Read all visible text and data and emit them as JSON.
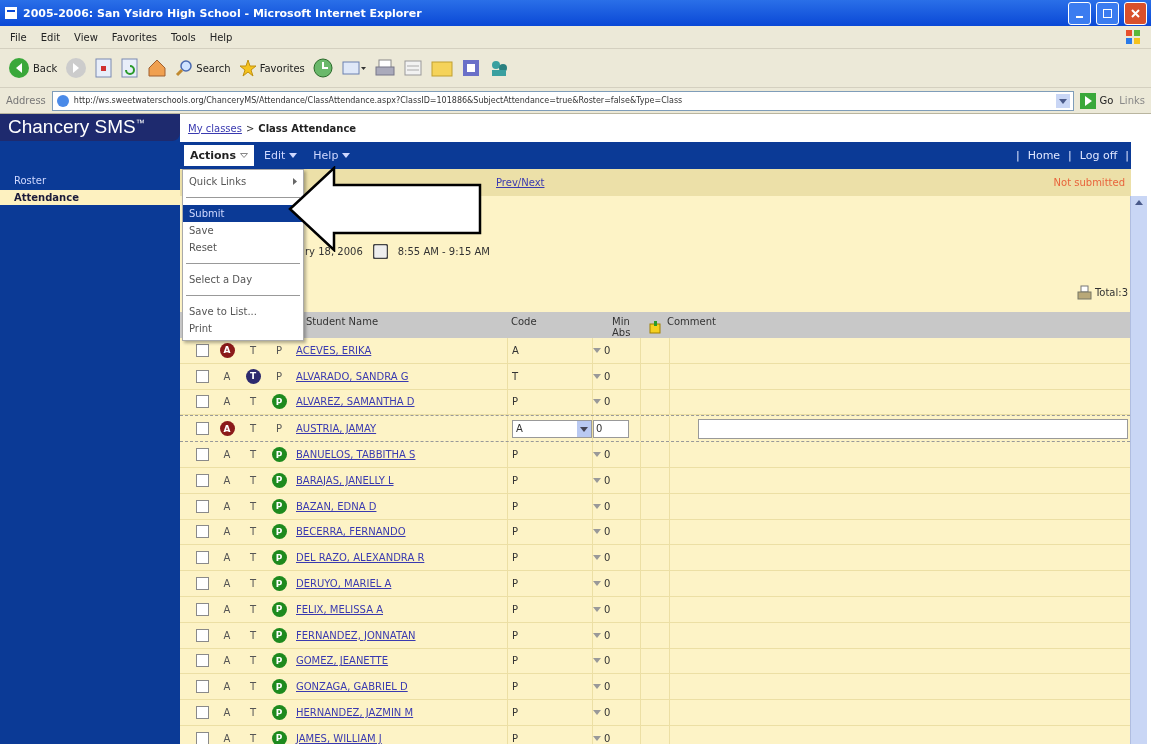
{
  "window": {
    "title": "2005-2006: San Ysidro High School - Microsoft Internet Explorer"
  },
  "menu_bar": [
    "File",
    "Edit",
    "View",
    "Favorites",
    "Tools",
    "Help"
  ],
  "toolbar": {
    "back": "Back",
    "search": "Search",
    "favorites": "Favorites"
  },
  "address_bar": {
    "label": "Address",
    "url": "http://ws.sweetwaterschools.org/ChanceryMS/Attendance/ClassAttendance.aspx?ClassID=101886&SubjectAttendance=true&Roster=false&Type=Class",
    "go": "Go",
    "links": "Links"
  },
  "sidebar": {
    "logo": "Chancery SMS",
    "logo_mark": "™",
    "items": [
      {
        "label": "Roster",
        "selected": false
      },
      {
        "label": "Attendance",
        "selected": true
      }
    ]
  },
  "breadcrumb": {
    "link": "My classes",
    "separator": ">",
    "current": "Class Attendance"
  },
  "nav": {
    "menus": [
      {
        "label": "Actions",
        "open": true
      },
      {
        "label": "Edit",
        "open": false
      },
      {
        "label": "Help",
        "open": false
      }
    ],
    "separator": "|",
    "links": [
      "Home",
      "Log off"
    ]
  },
  "status_bar": {
    "pager": "Prev/Next",
    "status": "Not submitted"
  },
  "session": {
    "date": "ry 18, 2006",
    "time": "8:55 AM - 9:15 AM"
  },
  "total": "Total:3",
  "actions_menu": [
    {
      "kind": "submenu",
      "label": "Quick Links",
      "selected": false
    },
    {
      "kind": "separator"
    },
    {
      "kind": "item",
      "label": "Submit",
      "selected": true
    },
    {
      "kind": "item",
      "label": "Save",
      "selected": false
    },
    {
      "kind": "item",
      "label": "Reset",
      "selected": false
    },
    {
      "kind": "separator"
    },
    {
      "kind": "item",
      "label": "Select a Day",
      "selected": false
    },
    {
      "kind": "separator"
    },
    {
      "kind": "item",
      "label": "Save to List...",
      "selected": false
    },
    {
      "kind": "item",
      "label": "Print",
      "selected": false
    }
  ],
  "table": {
    "columns": [
      "Student Name",
      "Code",
      "Min Abs",
      "Comment"
    ],
    "rows": [
      {
        "marks": [
          {
            "label": "A",
            "selected": true
          },
          {
            "label": "T",
            "selected": false
          },
          {
            "label": "P",
            "selected": false
          }
        ],
        "name": "ACEVES, ERIKA",
        "code": "A",
        "minutes": "0",
        "editing": false
      },
      {
        "marks": [
          {
            "label": "A",
            "selected": false
          },
          {
            "label": "T",
            "selected": true
          },
          {
            "label": "P",
            "selected": false
          }
        ],
        "name": "ALVARADO, SANDRA G",
        "code": "T",
        "minutes": "0",
        "editing": false
      },
      {
        "marks": [
          {
            "label": "A",
            "selected": false
          },
          {
            "label": "T",
            "selected": false
          },
          {
            "label": "P",
            "selected": true
          }
        ],
        "name": "ALVAREZ, SAMANTHA D",
        "code": "P",
        "minutes": "0",
        "editing": false
      },
      {
        "marks": [
          {
            "label": "A",
            "selected": true
          },
          {
            "label": "T",
            "selected": false
          },
          {
            "label": "P",
            "selected": false
          }
        ],
        "name": "AUSTRIA, JAMAY",
        "code": "A",
        "minutes": "0",
        "editing": true
      },
      {
        "marks": [
          {
            "label": "A",
            "selected": false
          },
          {
            "label": "T",
            "selected": false
          },
          {
            "label": "P",
            "selected": true
          }
        ],
        "name": "BANUELOS, TABBITHA S",
        "code": "P",
        "minutes": "0",
        "editing": false
      },
      {
        "marks": [
          {
            "label": "A",
            "selected": false
          },
          {
            "label": "T",
            "selected": false
          },
          {
            "label": "P",
            "selected": true
          }
        ],
        "name": "BARAJAS, JANELLY L",
        "code": "P",
        "minutes": "0",
        "editing": false
      },
      {
        "marks": [
          {
            "label": "A",
            "selected": false
          },
          {
            "label": "T",
            "selected": false
          },
          {
            "label": "P",
            "selected": true
          }
        ],
        "name": "BAZAN, EDNA D",
        "code": "P",
        "minutes": "0",
        "editing": false
      },
      {
        "marks": [
          {
            "label": "A",
            "selected": false
          },
          {
            "label": "T",
            "selected": false
          },
          {
            "label": "P",
            "selected": true
          }
        ],
        "name": "BECERRA, FERNANDO",
        "code": "P",
        "minutes": "0",
        "editing": false
      },
      {
        "marks": [
          {
            "label": "A",
            "selected": false
          },
          {
            "label": "T",
            "selected": false
          },
          {
            "label": "P",
            "selected": true
          }
        ],
        "name": "DEL RAZO, ALEXANDRA R",
        "code": "P",
        "minutes": "0",
        "editing": false
      },
      {
        "marks": [
          {
            "label": "A",
            "selected": false
          },
          {
            "label": "T",
            "selected": false
          },
          {
            "label": "P",
            "selected": true
          }
        ],
        "name": "DERUYO, MARIEL A",
        "code": "P",
        "minutes": "0",
        "editing": false
      },
      {
        "marks": [
          {
            "label": "A",
            "selected": false
          },
          {
            "label": "T",
            "selected": false
          },
          {
            "label": "P",
            "selected": true
          }
        ],
        "name": "FELIX, MELISSA A",
        "code": "P",
        "minutes": "0",
        "editing": false
      },
      {
        "marks": [
          {
            "label": "A",
            "selected": false
          },
          {
            "label": "T",
            "selected": false
          },
          {
            "label": "P",
            "selected": true
          }
        ],
        "name": "FERNANDEZ, JONNATAN",
        "code": "P",
        "minutes": "0",
        "editing": false
      },
      {
        "marks": [
          {
            "label": "A",
            "selected": false
          },
          {
            "label": "T",
            "selected": false
          },
          {
            "label": "P",
            "selected": true
          }
        ],
        "name": "GOMEZ, JEANETTE",
        "code": "P",
        "minutes": "0",
        "editing": false
      },
      {
        "marks": [
          {
            "label": "A",
            "selected": false
          },
          {
            "label": "T",
            "selected": false
          },
          {
            "label": "P",
            "selected": true
          }
        ],
        "name": "GONZAGA, GABRIEL D",
        "code": "P",
        "minutes": "0",
        "editing": false
      },
      {
        "marks": [
          {
            "label": "A",
            "selected": false
          },
          {
            "label": "T",
            "selected": false
          },
          {
            "label": "P",
            "selected": true
          }
        ],
        "name": "HERNANDEZ, JAZMIN M",
        "code": "P",
        "minutes": "0",
        "editing": false
      },
      {
        "marks": [
          {
            "label": "A",
            "selected": false
          },
          {
            "label": "T",
            "selected": false
          },
          {
            "label": "P",
            "selected": true
          }
        ],
        "name": "JAMES, WILLIAM J",
        "code": "P",
        "minutes": "0",
        "editing": false
      }
    ]
  }
}
